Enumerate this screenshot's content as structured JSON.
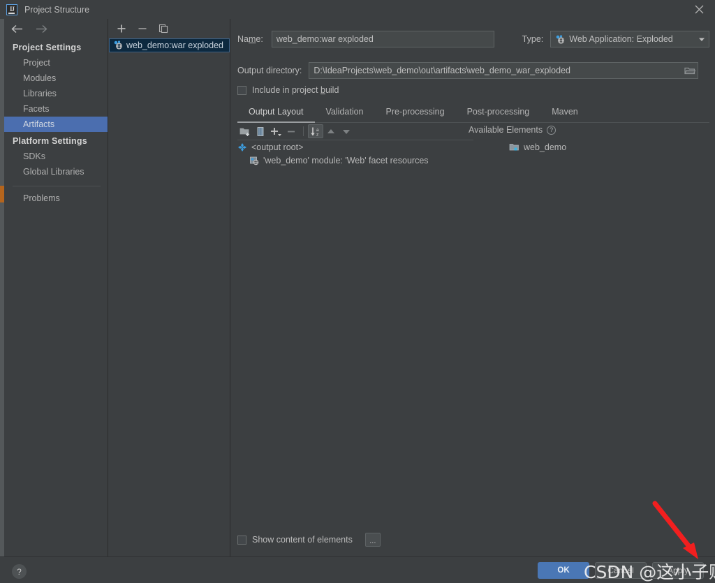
{
  "window": {
    "title": "Project Structure",
    "logo_text": "IJ",
    "close_icon": "close-icon"
  },
  "nav": {
    "back_icon": "arrow-left-icon",
    "forward_icon": "arrow-right-icon"
  },
  "sidebar": {
    "sections": [
      {
        "header": "Project Settings",
        "items": [
          {
            "label": "Project",
            "selected": false
          },
          {
            "label": "Modules",
            "selected": false
          },
          {
            "label": "Libraries",
            "selected": false
          },
          {
            "label": "Facets",
            "selected": false
          },
          {
            "label": "Artifacts",
            "selected": true
          }
        ]
      },
      {
        "header": "Platform Settings",
        "items": [
          {
            "label": "SDKs",
            "selected": false
          },
          {
            "label": "Global Libraries",
            "selected": false
          }
        ]
      }
    ],
    "problems_label": "Problems",
    "selected_color": "#4b6eaf"
  },
  "artifacts_panel": {
    "toolbar": [
      {
        "name": "add-artifact-button",
        "glyph": "+"
      },
      {
        "name": "remove-artifact-button",
        "glyph": "−"
      },
      {
        "name": "copy-artifact-button",
        "glyph": "copy-icon"
      }
    ],
    "items": [
      {
        "label": "web_demo:war exploded",
        "icon": "web-artifact-icon",
        "selected": true
      }
    ]
  },
  "detail": {
    "name_label": "Name:",
    "name_value": "web_demo:war exploded",
    "type_label": "Type:",
    "type_value": "Web Application: Exploded",
    "type_icon": "web-artifact-icon",
    "output_label": "Output directory:",
    "output_value": "D:\\IdeaProjects\\web_demo\\out\\artifacts\\web_demo_war_exploded",
    "browse_icon": "folder-icon",
    "include_label": "Include in project build",
    "include_checked": false,
    "tabs": [
      {
        "label": "Output Layout",
        "active": true
      },
      {
        "label": "Validation",
        "active": false
      },
      {
        "label": "Pre-processing",
        "active": false
      },
      {
        "label": "Post-processing",
        "active": false
      },
      {
        "label": "Maven",
        "active": false
      }
    ],
    "layout_toolbar": [
      {
        "name": "add-directory-button",
        "icon": "folder-add-icon",
        "enabled": true,
        "boxed": false
      },
      {
        "name": "add-archive-button",
        "icon": "archive-icon",
        "enabled": true,
        "boxed": false
      },
      {
        "name": "add-copy-button",
        "icon": "plus-dropdown-icon",
        "enabled": true,
        "boxed": false
      },
      {
        "name": "remove-element-button",
        "icon": "minus-icon",
        "enabled": false,
        "boxed": false
      },
      {
        "name": "sort-button",
        "icon": "sort-az-icon",
        "enabled": true,
        "boxed": true
      },
      {
        "name": "move-up-button",
        "icon": "arrow-up-icon",
        "enabled": false,
        "boxed": false
      },
      {
        "name": "move-down-button",
        "icon": "arrow-down-icon",
        "enabled": false,
        "boxed": false
      }
    ],
    "tree": [
      {
        "label": "<output root>",
        "icon": "output-root-icon",
        "depth": 0
      },
      {
        "label": "'web_demo' module: 'Web' facet resources",
        "icon": "facet-resources-icon",
        "depth": 1
      }
    ],
    "available_elements_label": "Available Elements",
    "available_help_icon": "help-circle-icon",
    "available_items": [
      {
        "label": "web_demo",
        "icon": "module-icon"
      }
    ],
    "show_content_label": "Show content of elements",
    "show_content_checked": false,
    "more_button_label": "..."
  },
  "bottom": {
    "help_label": "?",
    "buttons": [
      {
        "name": "ok-button",
        "label": "OK",
        "primary": true
      },
      {
        "name": "cancel-button",
        "label": "Cancel",
        "primary": false
      },
      {
        "name": "apply-button",
        "label": "Apply",
        "primary": false
      }
    ],
    "ok_color": "#4a77b5"
  },
  "annotations": {
    "watermark_text": "CSDN @这小子贼帅",
    "arrow_color": "#f21f1f"
  }
}
